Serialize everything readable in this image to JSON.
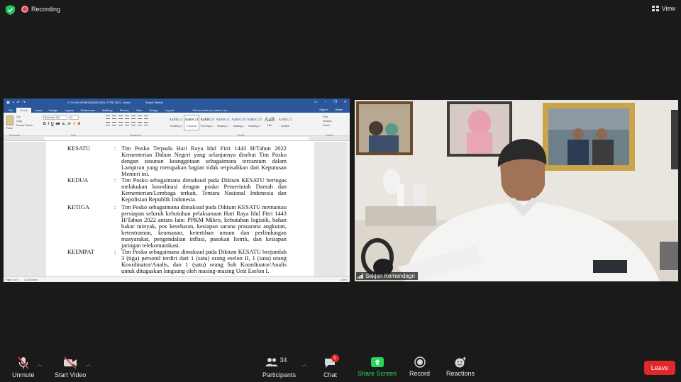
{
  "topbar": {
    "recording_label": "Recording",
    "view_label": "View"
  },
  "word": {
    "doc_title": "2. Fix SK KEMENDAGRI IDUL FITRI 2022 - Word",
    "sign_in": "Select Sheets",
    "tabs": [
      "File",
      "Home",
      "Insert",
      "Design",
      "Layout",
      "References",
      "Mailings",
      "Review",
      "View",
      "Design",
      "Layout"
    ],
    "tell_me": "Tell me what you want to do...",
    "sign_in_right": "Sign in",
    "share": "Share",
    "clipboard": {
      "paste": "Paste",
      "cut": "Cut",
      "copy": "Copy",
      "format_painter": "Format Painter",
      "group": "Clipboard"
    },
    "font": {
      "name": "Bookman Old",
      "size": "11",
      "group": "Font"
    },
    "paragraph_group": "Paragraph",
    "styles_group": "Styles",
    "editing_group": "Editing",
    "styles": [
      {
        "preview": "AaBbCcI",
        "name": "Heading 3"
      },
      {
        "preview": "AaBbCcI",
        "name": "¶ Normal"
      },
      {
        "preview": "AaBbCcI",
        "name": "¶ No Spac..."
      },
      {
        "preview": "AaBbCcI",
        "name": "Heading 1"
      },
      {
        "preview": "AaBbCcD",
        "name": "Heading 2"
      },
      {
        "preview": "AaBbCcD",
        "name": "Heading 4"
      },
      {
        "preview": "AaB",
        "name": "Title"
      },
      {
        "preview": "AaBbCcI",
        "name": "Subtitle"
      }
    ],
    "editing": {
      "find": "Find",
      "replace": "Replace",
      "select": "Select"
    },
    "status": {
      "page": "Page 2 of 5",
      "words": "1.180 words",
      "zoom": "110%"
    },
    "sections": [
      {
        "label": "KESATU",
        "text": "Tim Posko Terpadu Hari Raya Idul Fitri 1443 H/Tahun 2022 Kementerian Dalam Negeri yang selanjutnya disebut Tim Posko dengan susunan keanggotaan sebagaimana tercantum dalam Lampiran yang merupakan bagian tidak terpisahkan dari Keputusan Menteri ini."
      },
      {
        "label": "KEDUA",
        "text": "Tim Posko sebagaimana dimaksud pada Diktum KESATU bertugas melakukan koordinasi dengan posko Pemerintah Daerah dan Kementerian/Lembaga terkait, Tentara Nasional Indonesia dan Kepolisian Republik Indonesia."
      },
      {
        "label": "KETIGA",
        "text": "Tim Posko sebagaimana dimaksud pada Diktum KESATU memantau persiapan seluruh kebutuhan pelaksanaan Hari Raya Idul Fitri 1443 H/Tahun 2022 antara lain: PPKM Mikro, kebutuhan logistik, bahan bakar minyak, pos kesehatan, kesiapan sarana prasarana angkutan, ketentraman, keamanan, ketertiban umum dan perlindungan masyarakat, pengendalian inflasi, pasokan listrik, dan kesiapan jaringan telekomunikasi."
      },
      {
        "label": "KEEMPAT",
        "text": "Tim Posko sebagaimana dimaksud pada Diktum KESATU berjumlah 3 (tiga) personil terdiri dari 1 (satu) orang eselon II, 1 (satu) orang Koordinator/Analis, dan 1 (satu) orang Sub Koordinator/Analis untuk ditugaskan langsung oleh masing-masing Unit Eselon I."
      }
    ]
  },
  "video": {
    "participant_name": "Sekjen Kemendagri"
  },
  "toolbar": {
    "unmute": "Unmute",
    "start_video": "Start Video",
    "participants": "Participants",
    "participants_count": "34",
    "chat": "Chat",
    "chat_badge": "1",
    "share_screen": "Share Screen",
    "record": "Record",
    "reactions": "Reactions",
    "leave": "Leave"
  },
  "colors": {
    "word_blue": "#2b579a",
    "share_green": "#23d959",
    "leave_red": "#e02828"
  }
}
